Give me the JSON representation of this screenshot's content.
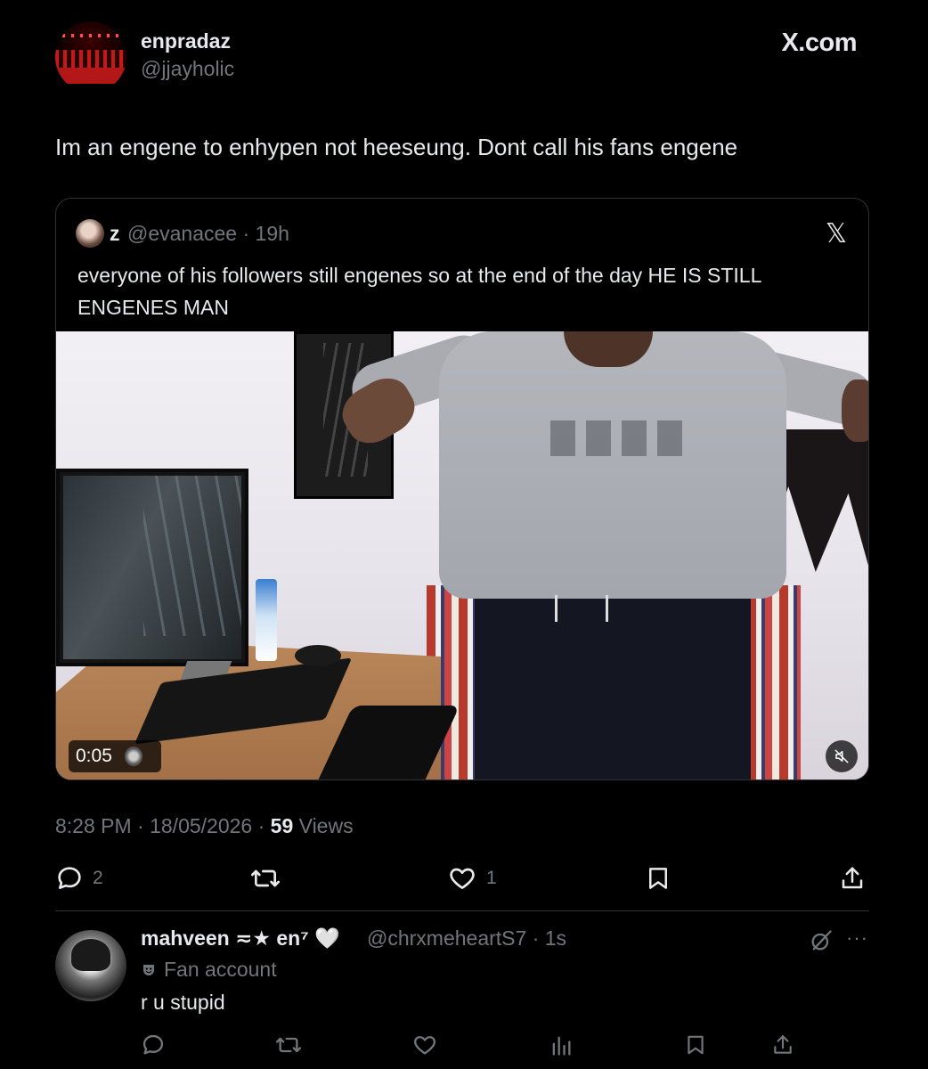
{
  "app": {
    "site_label": "X.com"
  },
  "author": {
    "display_name": "enpradaz",
    "handle": "@jjayholic"
  },
  "tweet": {
    "text": "Im an engene to enhypen not heeseung. Dont call his fans engene"
  },
  "quote": {
    "name": "z",
    "handle_time": "@evanacee · 19h",
    "text": "everyone of his followers still engenes so at the end of the day HE IS STILL ENGENES MAN",
    "video": {
      "duration": "0:05"
    }
  },
  "meta": {
    "time_date": "8:28 PM · 18/05/2026 · ",
    "views_count": "59",
    "views_label": " Views"
  },
  "actions": {
    "replies": "2",
    "likes": "1"
  },
  "reply": {
    "display_name": "mahveen ≂★ en⁷",
    "heart": " 🤍",
    "handle_time": "@chrxmeheartS7 · 1s",
    "label": "Fan account",
    "text": "r u stupid",
    "more": "···"
  },
  "colors": {
    "background": "#000000",
    "text": "#e7e9ea",
    "secondary": "#71767b",
    "border": "#2f3336"
  }
}
